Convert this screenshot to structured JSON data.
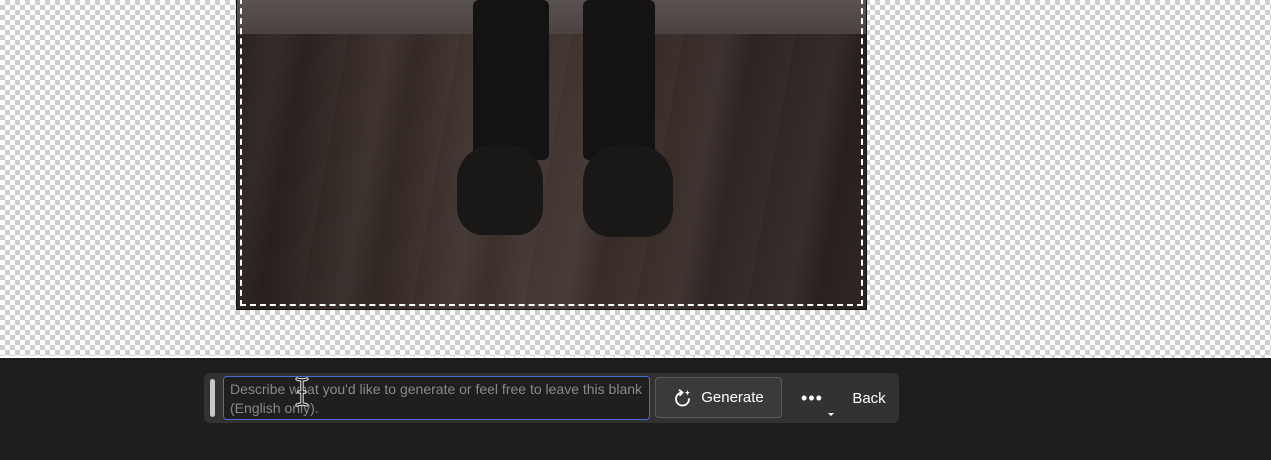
{
  "taskbar": {
    "prompt_placeholder": "Describe what you'd like to generate or feel free to leave this blank (English only).",
    "prompt_value": "",
    "generate_label": "Generate",
    "more_label": "•••",
    "back_label": "Back"
  },
  "icons": {
    "generate": "generate-sparkle-icon",
    "more": "more-options-icon",
    "cursor": "text-cursor-icon"
  },
  "colors": {
    "input_focus_border": "#4b6bd8",
    "taskbar_bg": "#323232",
    "panel_bg": "#1e1e1e"
  }
}
